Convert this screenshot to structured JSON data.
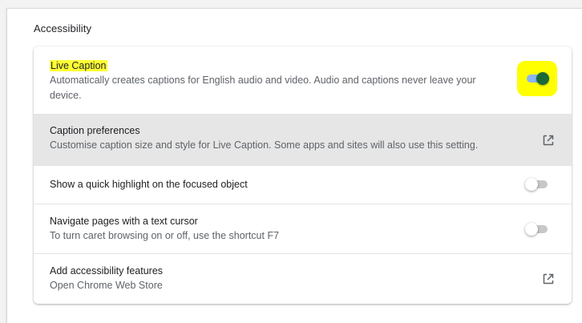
{
  "section": {
    "title": "Accessibility"
  },
  "rows": {
    "live_caption": {
      "title": "Live Caption",
      "description_line1": "Automatically creates captions for English audio and video. Audio and captions never leave your",
      "description_line2": "device.",
      "toggle_state": "on",
      "highlight_color": "#ffff00"
    },
    "caption_preferences": {
      "title": "Caption preferences",
      "description": "Customise caption size and style for Live Caption. Some apps and sites will also use this setting.",
      "icon": "open-in-new-icon"
    },
    "focus_highlight": {
      "title": "Show a quick highlight on the focused object",
      "toggle_state": "off"
    },
    "caret_browsing": {
      "title": "Navigate pages with a text cursor",
      "description": "To turn caret browsing on or off, use the shortcut F7",
      "toggle_state": "off"
    },
    "add_features": {
      "title": "Add accessibility features",
      "description": "Open Chrome Web Store",
      "icon": "open-in-new-icon"
    }
  },
  "colors": {
    "toggle_on_track": "#8ab4f8",
    "toggle_on_knob": "#1a6a3a",
    "hover_row": "#e6e6e6"
  }
}
